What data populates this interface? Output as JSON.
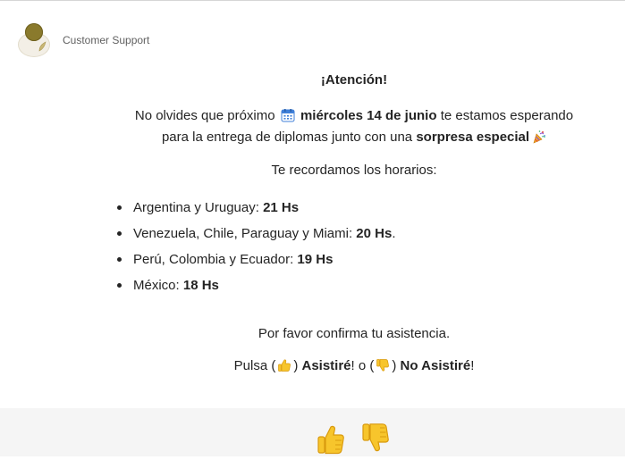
{
  "sender": {
    "name": "Customer Support"
  },
  "message": {
    "title": "¡Atención!",
    "intro": {
      "part1": "No olvides que próximo",
      "date_bold": "miércoles 14 de junio",
      "part2": "te estamos esperando",
      "part3": "para la entrega de diplomas junto con una",
      "surprise_bold": "sorpresa especial"
    },
    "schedule_heading": "Te recordamos los horarios:",
    "schedule": [
      {
        "region": "Argentina y Uruguay: ",
        "time": "21 Hs",
        "suffix": ""
      },
      {
        "region": "Venezuela, Chile, Paraguay y Miami: ",
        "time": "20 Hs",
        "suffix": "."
      },
      {
        "region": "Perú, Colombia y Ecuador: ",
        "time": "19 Hs",
        "suffix": ""
      },
      {
        "region": "México: ",
        "time": "18 Hs",
        "suffix": ""
      }
    ],
    "confirm": "Por favor confirma tu asistencia.",
    "pulsa": {
      "prefix": "Pulsa (",
      "mid1": ")",
      "attend_bold": "Asistiré",
      "mid2": "! o (",
      "mid3": ")",
      "not_attend_bold": "No Asistiré",
      "suffix": "!"
    }
  },
  "icons": {
    "calendar": "calendar-icon",
    "party": "party-popper-icon",
    "thumbs_up": "thumbs-up-icon",
    "thumbs_down": "thumbs-down-icon"
  },
  "colors": {
    "emoji_yellow": "#f7c52c",
    "emoji_outline": "#d99a0e",
    "calendar_blue": "#3f7fd8",
    "reaction_bar_bg": "#f5f5f5"
  }
}
